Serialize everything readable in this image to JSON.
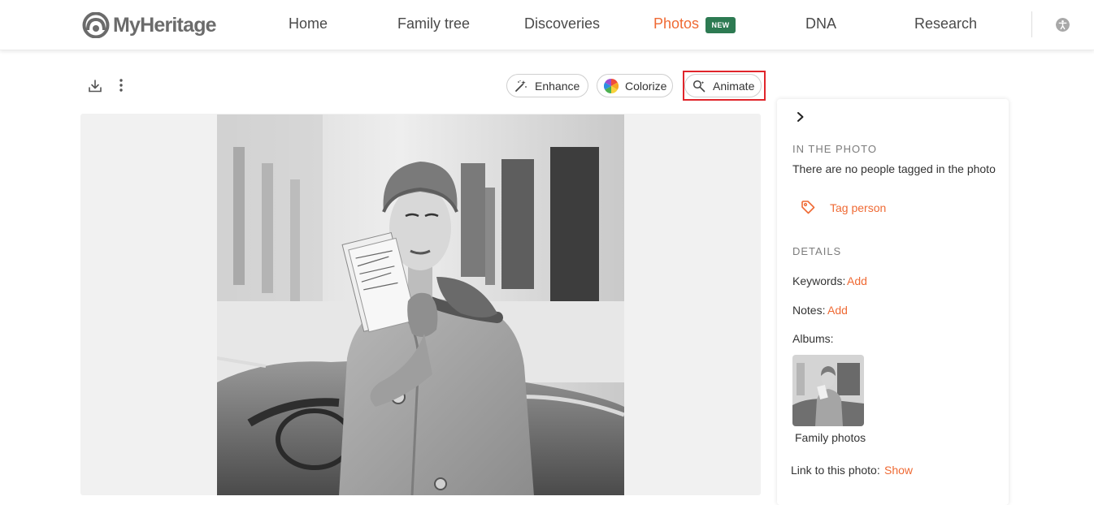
{
  "brand": {
    "name": "MyHeritage"
  },
  "nav": {
    "items": [
      {
        "label": "Home"
      },
      {
        "label": "Family tree"
      },
      {
        "label": "Discoveries"
      },
      {
        "label": "Photos",
        "badge": "NEW"
      },
      {
        "label": "DNA"
      },
      {
        "label": "Research"
      }
    ],
    "active": "Photos"
  },
  "toolbar": {
    "enhance_label": "Enhance",
    "colorize_label": "Colorize",
    "animate_label": "Animate"
  },
  "panel": {
    "in_photo_title": "IN THE PHOTO",
    "no_people_text": "There are no people tagged in the photo",
    "tag_person_label": "Tag person",
    "details_title": "DETAILS",
    "keywords_label": "Keywords:",
    "keywords_action": "Add",
    "notes_label": "Notes:",
    "notes_action": "Add",
    "albums_label": "Albums:",
    "album_name": "Family photos",
    "link_label": "Link to this photo:",
    "link_action": "Show"
  },
  "colors": {
    "accent": "#ef6a34",
    "new_badge": "#2d7a52",
    "highlight_box": "#e0252b",
    "nav_text": "#4a4a4a"
  },
  "icons": [
    "myheritage-logo-icon",
    "accessibility-icon",
    "download-icon",
    "more-vertical-icon",
    "magic-wand-icon",
    "color-wheel-icon",
    "animate-icon",
    "chevron-right-icon",
    "tag-icon"
  ]
}
